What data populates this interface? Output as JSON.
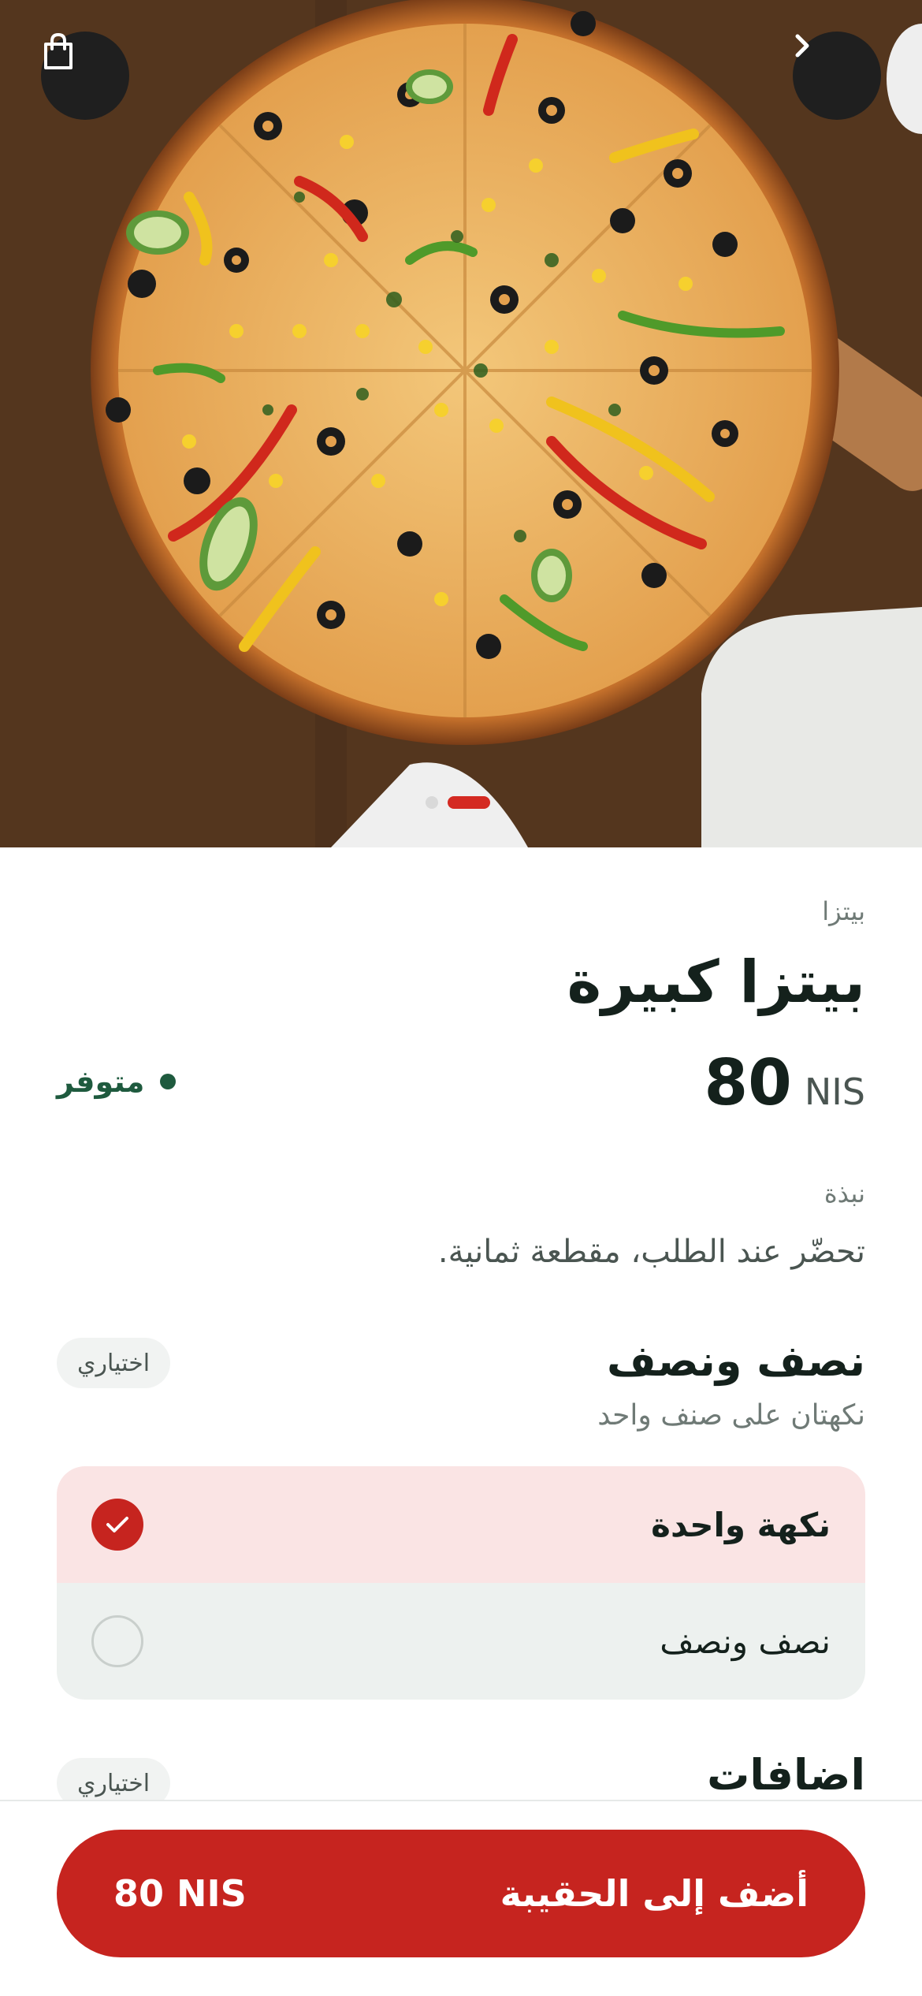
{
  "header": {
    "bag_icon": "shopping-bag-icon",
    "back_icon": "chevron-right-icon",
    "slide_count": 2,
    "active_slide": 2
  },
  "product": {
    "category": "بيتزا",
    "title": "بيتزا كبيرة",
    "price_value": "80",
    "price_currency": "NIS",
    "availability": "متوفر",
    "description_label": "نبذة",
    "description": "تحضّر عند الطلب، مقطعة ثمانية."
  },
  "sections": [
    {
      "title": "نصف ونصف",
      "subtitle": "نكهتان على صنف واحد",
      "badge": "اختياري",
      "options": [
        {
          "label": "نكهة واحدة",
          "selected": true
        },
        {
          "label": "نصف ونصف",
          "selected": false
        }
      ]
    },
    {
      "title": "اضافات",
      "badge": "اختياري"
    }
  ],
  "cart_button": {
    "label": "أضف إلى الحقيبة",
    "price": "80 NIS"
  },
  "colors": {
    "accent": "#c6241f",
    "available": "#1e5a3e",
    "selected_bg": "#fae4e4",
    "unselected_bg": "#edf1ef"
  }
}
